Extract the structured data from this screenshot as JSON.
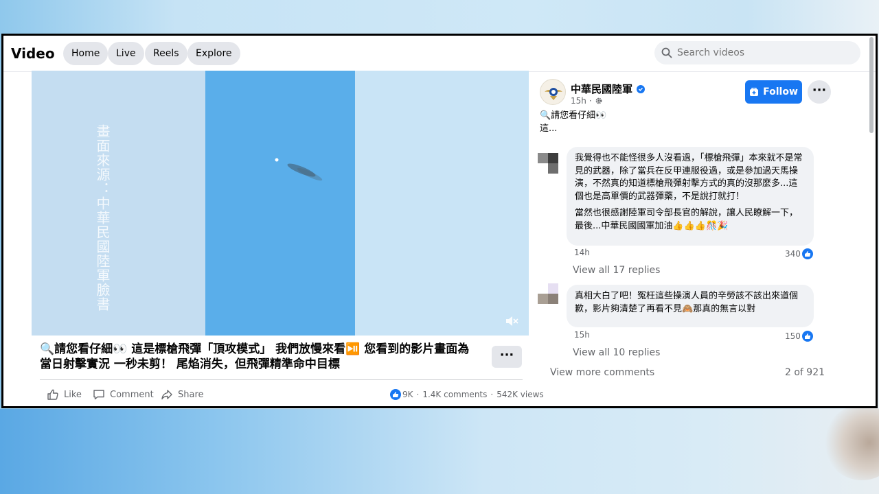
{
  "header": {
    "title": "Video",
    "nav": [
      "Home",
      "Live",
      "Reels",
      "Explore"
    ],
    "search_placeholder": "Search videos"
  },
  "video": {
    "watermark": "畫面來源：中華民國陸軍臉書",
    "muted": true
  },
  "post": {
    "title": "🔍請您看仔細👀 這是標槍飛彈「頂攻模式」 我們放慢來看⏯️ 您看到的影片畫面為當日射擊實況 一秒未剪！ 尾焰消失，但飛彈精準命中目標",
    "more_label": "···",
    "actions": {
      "like": "Like",
      "comment": "Comment",
      "share": "Share"
    },
    "stats": {
      "reactions": "9K",
      "comments": "1.4K comments",
      "views": "542K views"
    }
  },
  "page": {
    "name": "中華民國陸軍",
    "time": "15h ·",
    "follow_label": "Follow",
    "caption_line1": "🔍請您看仔細👀",
    "caption_line2": "這..."
  },
  "comments": [
    {
      "text1": "我覺得也不能怪很多人沒看過，「標槍飛彈」本來就不是常見的武器，除了當兵在反甲連服役過，或是參加過天馬操演，不然真的知道標槍飛彈射擊方式的真的沒那麼多...這個也是高單價的武器彈藥，不是說打就打！",
      "text2": "當然也很感謝陸軍司令部長官的解說，讓人民瞭解一下，最後...中華民國國軍加油👍👍👍🎊🎉",
      "time": "14h",
      "likes": "340",
      "replies": "View all 17 replies"
    },
    {
      "text1": "真相大白了吧！冤枉這些操演人員的辛勞該不該出來道個歉，影片夠清楚了再看不見🙈那真的無言以對",
      "time": "15h",
      "likes": "150",
      "replies": "View all 10 replies"
    }
  ],
  "footer": {
    "view_more": "View more comments",
    "pager": "2 of 921"
  }
}
